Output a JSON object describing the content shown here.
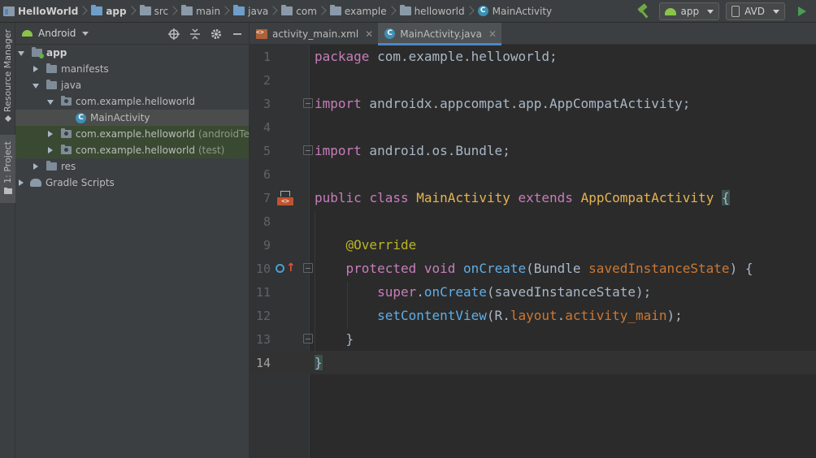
{
  "breadcrumbs": [
    {
      "label": "HelloWorld",
      "icon": "project-icon",
      "bold": true
    },
    {
      "label": "app",
      "icon": "module-folder-icon",
      "bold": true
    },
    {
      "label": "src",
      "icon": "folder-icon",
      "bold": false
    },
    {
      "label": "main",
      "icon": "folder-icon",
      "bold": false
    },
    {
      "label": "java",
      "icon": "source-folder-icon",
      "bold": false
    },
    {
      "label": "com",
      "icon": "package-icon",
      "bold": false
    },
    {
      "label": "example",
      "icon": "package-icon",
      "bold": false
    },
    {
      "label": "helloworld",
      "icon": "package-icon",
      "bold": false
    },
    {
      "label": "MainActivity",
      "icon": "class-icon",
      "bold": false
    }
  ],
  "toolbar": {
    "run_config": "app",
    "device": "AVD",
    "class_glyph": "C"
  },
  "toolstrip": {
    "resource_manager": "Resource Manager",
    "project": "1: Project"
  },
  "project_panel": {
    "view_mode": "Android",
    "header_icons": [
      "crosshair-icon",
      "collapse-icon",
      "gear-icon",
      "minimize-icon"
    ],
    "tree": [
      {
        "label": "app",
        "icon": "module-icon",
        "expanded": true,
        "bold": true
      },
      {
        "label": "manifests",
        "icon": "folder-icon",
        "expanded": false
      },
      {
        "label": "java",
        "icon": "folder-icon",
        "expanded": true
      },
      {
        "label": "com.example.helloworld",
        "icon": "package-icon",
        "expanded": true
      },
      {
        "label": "MainActivity",
        "icon": "class-icon",
        "selected": true
      },
      {
        "label": "com.example.helloworld",
        "suffix": "(androidTest)",
        "icon": "package-icon",
        "expanded": false
      },
      {
        "label": "com.example.helloworld",
        "suffix": "(test)",
        "icon": "package-icon",
        "expanded": false
      },
      {
        "label": "res",
        "icon": "folder-icon",
        "expanded": false
      },
      {
        "label": "Gradle Scripts",
        "icon": "gradle-icon",
        "expanded": false
      }
    ]
  },
  "editor": {
    "tabs": [
      {
        "label": "activity_main.xml",
        "icon": "xml-layout-icon",
        "active": false
      },
      {
        "label": "MainActivity.java",
        "icon": "class-icon",
        "active": true
      }
    ],
    "current_line": 14,
    "colors": {
      "keyword": "#cc7832",
      "annotation": "#bbb529",
      "method": "#5faee6",
      "default": "#a9b7c6"
    },
    "lines": [
      {
        "n": "1",
        "text": "package com.example.helloworld;"
      },
      {
        "n": "2",
        "text": ""
      },
      {
        "n": "3",
        "text": "import androidx.appcompat.app.AppCompatActivity;"
      },
      {
        "n": "4",
        "text": ""
      },
      {
        "n": "5",
        "text": "import android.os.Bundle;"
      },
      {
        "n": "6",
        "text": ""
      },
      {
        "n": "7",
        "text": "public class MainActivity extends AppCompatActivity {"
      },
      {
        "n": "8",
        "text": ""
      },
      {
        "n": "9",
        "text": "    @Override"
      },
      {
        "n": "10",
        "text": "    protected void onCreate(Bundle savedInstanceState) {"
      },
      {
        "n": "11",
        "text": "        super.onCreate(savedInstanceState);"
      },
      {
        "n": "12",
        "text": "        setContentView(R.layout.activity_main);"
      },
      {
        "n": "13",
        "text": "    }"
      },
      {
        "n": "14",
        "text": "}"
      }
    ]
  }
}
